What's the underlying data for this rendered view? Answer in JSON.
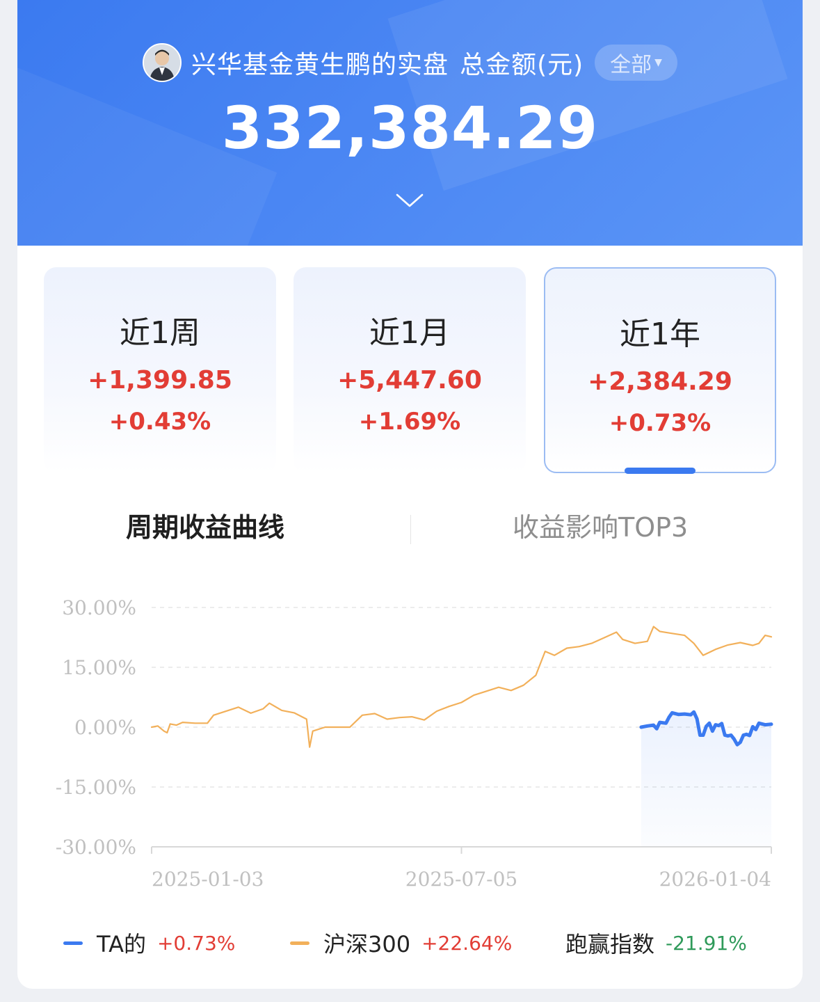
{
  "header": {
    "owner_name": "兴华基金黄生鹏的实盘",
    "total_label": "总金额(元)",
    "filter_label": "全部",
    "total_value": "332,384.29"
  },
  "periods": [
    {
      "label": "近1周",
      "value": "+1,399.85",
      "pct": "+0.43%",
      "selected": false
    },
    {
      "label": "近1月",
      "value": "+5,447.60",
      "pct": "+1.69%",
      "selected": false
    },
    {
      "label": "近1年",
      "value": "+2,384.29",
      "pct": "+0.73%",
      "selected": true
    }
  ],
  "tabs": {
    "active": "周期收益曲线",
    "inactive": "收益影响TOP3"
  },
  "chart_data": {
    "type": "line",
    "y_ticks": [
      "30.00%",
      "15.00%",
      "0.00%",
      "-15.00%",
      "-30.00%"
    ],
    "x_ticks": [
      "2025-01-03",
      "2025-07-05",
      "2026-01-04"
    ],
    "ylim": [
      -30,
      30
    ],
    "grid": true,
    "series": [
      {
        "name": "TA的",
        "color": "#3b7af0",
        "points": [
          [
            0.79,
            0
          ],
          [
            0.8,
            0.3
          ],
          [
            0.81,
            0.5
          ],
          [
            0.815,
            -0.4
          ],
          [
            0.82,
            1.2
          ],
          [
            0.83,
            1
          ],
          [
            0.835,
            2.5
          ],
          [
            0.84,
            3.6
          ],
          [
            0.85,
            3.2
          ],
          [
            0.86,
            3.3
          ],
          [
            0.87,
            3.1
          ],
          [
            0.875,
            3.8
          ],
          [
            0.88,
            2.1
          ],
          [
            0.885,
            -2.0
          ],
          [
            0.89,
            -2.0
          ],
          [
            0.895,
            0.2
          ],
          [
            0.9,
            1.0
          ],
          [
            0.905,
            -1.0
          ],
          [
            0.91,
            0.6
          ],
          [
            0.915,
            0.4
          ],
          [
            0.92,
            0.9
          ],
          [
            0.925,
            -2.0
          ],
          [
            0.93,
            -2.2
          ],
          [
            0.935,
            -2.0
          ],
          [
            0.94,
            -3.0
          ],
          [
            0.945,
            -4.4
          ],
          [
            0.95,
            -3.8
          ],
          [
            0.955,
            -2.0
          ],
          [
            0.96,
            -1.8
          ],
          [
            0.965,
            -2.1
          ],
          [
            0.97,
            0.1
          ],
          [
            0.975,
            -0.6
          ],
          [
            0.98,
            1.0
          ],
          [
            0.99,
            0.6
          ],
          [
            1.0,
            0.73
          ]
        ]
      },
      {
        "name": "沪深300",
        "color": "#f2b05a",
        "points": [
          [
            0,
            0
          ],
          [
            0.01,
            0.3
          ],
          [
            0.02,
            -1.0
          ],
          [
            0.025,
            -1.4
          ],
          [
            0.03,
            0.8
          ],
          [
            0.04,
            0.5
          ],
          [
            0.05,
            1.2
          ],
          [
            0.07,
            1.0
          ],
          [
            0.09,
            1.0
          ],
          [
            0.1,
            3.0
          ],
          [
            0.12,
            4.0
          ],
          [
            0.14,
            5.0
          ],
          [
            0.16,
            3.5
          ],
          [
            0.18,
            4.6
          ],
          [
            0.19,
            6.0
          ],
          [
            0.21,
            4.2
          ],
          [
            0.23,
            3.6
          ],
          [
            0.25,
            2.0
          ],
          [
            0.255,
            -5.0
          ],
          [
            0.26,
            -1.0
          ],
          [
            0.28,
            0
          ],
          [
            0.32,
            0
          ],
          [
            0.34,
            3.0
          ],
          [
            0.36,
            3.4
          ],
          [
            0.38,
            2.0
          ],
          [
            0.4,
            2.4
          ],
          [
            0.42,
            2.6
          ],
          [
            0.44,
            1.8
          ],
          [
            0.46,
            4.0
          ],
          [
            0.48,
            5.2
          ],
          [
            0.5,
            6.2
          ],
          [
            0.52,
            8.0
          ],
          [
            0.54,
            9.0
          ],
          [
            0.56,
            10.0
          ],
          [
            0.58,
            9.2
          ],
          [
            0.6,
            10.5
          ],
          [
            0.62,
            13.0
          ],
          [
            0.635,
            19.0
          ],
          [
            0.65,
            18.0
          ],
          [
            0.67,
            19.8
          ],
          [
            0.69,
            20.2
          ],
          [
            0.71,
            21.0
          ],
          [
            0.73,
            22.4
          ],
          [
            0.75,
            23.8
          ],
          [
            0.76,
            22.0
          ],
          [
            0.78,
            21.0
          ],
          [
            0.8,
            21.5
          ],
          [
            0.81,
            25.2
          ],
          [
            0.82,
            24.0
          ],
          [
            0.84,
            23.5
          ],
          [
            0.86,
            23.0
          ],
          [
            0.875,
            21.0
          ],
          [
            0.89,
            18.0
          ],
          [
            0.91,
            19.5
          ],
          [
            0.93,
            20.6
          ],
          [
            0.95,
            21.2
          ],
          [
            0.97,
            20.5
          ],
          [
            0.98,
            21.0
          ],
          [
            0.99,
            23.0
          ],
          [
            1.0,
            22.64
          ]
        ]
      }
    ]
  },
  "legend": [
    {
      "name": "TA的",
      "value": "+0.73%",
      "color": "#3b7af0",
      "value_color": "#e23d35"
    },
    {
      "name": "沪深300",
      "value": "+22.64%",
      "color": "#f2b05a",
      "value_color": "#e23d35"
    },
    {
      "name": "跑赢指数",
      "value": "-21.91%",
      "color": "",
      "value_color": "#2f9a5a"
    }
  ]
}
